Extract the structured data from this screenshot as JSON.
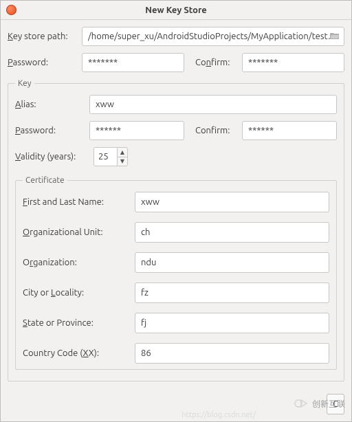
{
  "window_title": "New Key Store",
  "labels": {
    "key_store_path": "Key store path:",
    "password": "Password:",
    "confirm": "Confirm:",
    "key_legend": "Key",
    "alias": "Alias:",
    "key_password": "Password:",
    "key_confirm": "Confirm:",
    "validity": "Validity (years):",
    "certificate_legend": "Certificate",
    "first_last": "First and Last Name:",
    "org_unit": "Organizational Unit:",
    "organization": "Organization:",
    "city": "City or Locality:",
    "state": "State or Province:",
    "country": "Country Code (XX):"
  },
  "values": {
    "key_store_path": "/home/super_xu/AndroidStudioProjects/MyApplication/test.jks",
    "password": "*******",
    "confirm": "*******",
    "alias": "xww",
    "key_password": "******",
    "key_confirm": "******",
    "validity_years": "25",
    "first_last": "xww",
    "org_unit": "ch",
    "organization": "ndu",
    "city": "fz",
    "state": "fj",
    "country": "86"
  },
  "footer_button": "C",
  "watermark": "创新互联",
  "faint_url": "https://blog.csdn.net/"
}
